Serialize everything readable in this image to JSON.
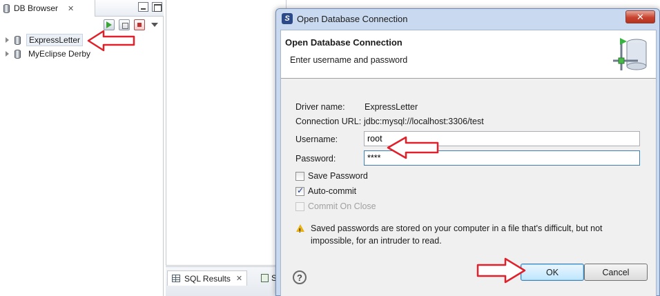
{
  "db_browser": {
    "tab_title": "DB Browser",
    "tree": [
      {
        "label": "ExpressLetter",
        "selected": true
      },
      {
        "label": "MyEclipse Derby",
        "selected": false
      }
    ]
  },
  "bottom_panel": {
    "tabs": [
      {
        "label": "SQL Results"
      },
      {
        "label": "S"
      }
    ]
  },
  "dialog": {
    "window_title": "Open Database Connection",
    "close_glyph": "✕",
    "banner_title": "Open Database Connection",
    "banner_subtitle": "Enter username and password",
    "driver_name_label": "Driver name:",
    "driver_name_value": "ExpressLetter",
    "connection_url_label": "Connection URL:",
    "connection_url_value": "jdbc:mysql://localhost:3306/test",
    "username_label": "Username:",
    "username_value": "root",
    "password_label": "Password:",
    "password_value": "****",
    "save_password_label": "Save Password",
    "save_password_checked": false,
    "auto_commit_label": "Auto-commit",
    "auto_commit_checked": true,
    "commit_on_close_label": "Commit On Close",
    "commit_on_close_enabled": false,
    "warning_line1": "Saved passwords are stored on your computer in a file that's difficult, but not",
    "warning_line2": "impossible, for an intruder to read.",
    "help_glyph": "?",
    "ok_label": "OK",
    "cancel_label": "Cancel"
  },
  "colors": {
    "annotation_arrow": "#e0202a",
    "dialog_frame": "#c9d9ef",
    "ok_button": "#bee6fd"
  },
  "icons": [
    "db-icon",
    "connect-icon",
    "disconnect-icon",
    "refresh-icon",
    "view-menu-icon",
    "database-icon",
    "sql-grid-icon",
    "app-icon",
    "close-icon",
    "banner-database-icon",
    "warning-icon",
    "help-icon",
    "annotation-arrow"
  ]
}
